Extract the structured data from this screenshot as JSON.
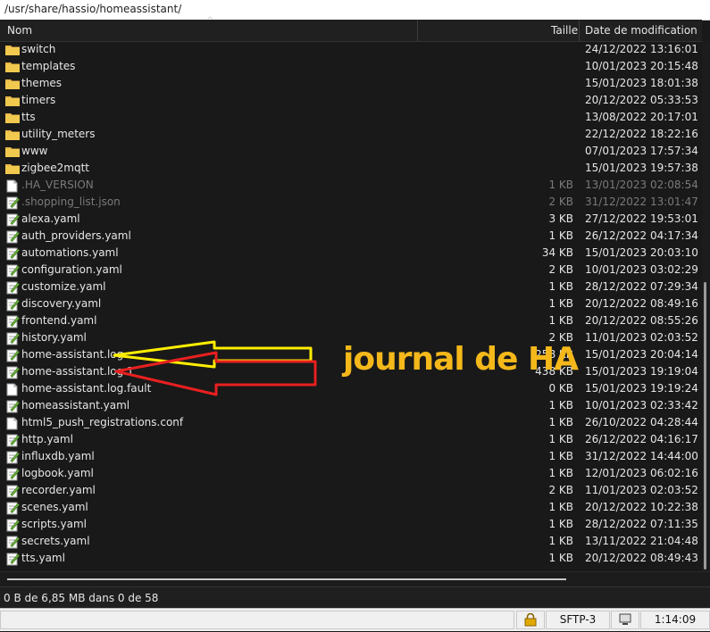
{
  "path": "/usr/share/hassio/homeassistant/",
  "columns": {
    "name": "Nom",
    "size": "Taille",
    "date": "Date de modification"
  },
  "rows": [
    {
      "name": "switch",
      "size": "",
      "date": "24/12/2022 13:16:01",
      "type": "folder"
    },
    {
      "name": "templates",
      "size": "",
      "date": "10/01/2023 20:15:48",
      "type": "folder"
    },
    {
      "name": "themes",
      "size": "",
      "date": "15/01/2023 18:01:38",
      "type": "folder"
    },
    {
      "name": "timers",
      "size": "",
      "date": "20/12/2022 05:33:53",
      "type": "folder"
    },
    {
      "name": "tts",
      "size": "",
      "date": "13/08/2022 20:17:01",
      "type": "folder"
    },
    {
      "name": "utility_meters",
      "size": "",
      "date": "22/12/2022 18:22:16",
      "type": "folder"
    },
    {
      "name": "www",
      "size": "",
      "date": "07/01/2023 17:57:34",
      "type": "folder"
    },
    {
      "name": "zigbee2mqtt",
      "size": "",
      "date": "15/01/2023 19:57:38",
      "type": "folder"
    },
    {
      "name": ".HA_VERSION",
      "size": "1 KB",
      "date": "13/01/2023 02:08:54",
      "type": "file",
      "hidden": true
    },
    {
      "name": ".shopping_list.json",
      "size": "2 KB",
      "date": "31/12/2022 13:01:47",
      "type": "note",
      "hidden": true
    },
    {
      "name": "alexa.yaml",
      "size": "3 KB",
      "date": "27/12/2022 19:53:01",
      "type": "note"
    },
    {
      "name": "auth_providers.yaml",
      "size": "1 KB",
      "date": "26/12/2022 04:17:34",
      "type": "note"
    },
    {
      "name": "automations.yaml",
      "size": "34 KB",
      "date": "15/01/2023 20:03:10",
      "type": "note"
    },
    {
      "name": "configuration.yaml",
      "size": "2 KB",
      "date": "10/01/2023 03:02:29",
      "type": "note"
    },
    {
      "name": "customize.yaml",
      "size": "1 KB",
      "date": "28/12/2022 07:29:34",
      "type": "note"
    },
    {
      "name": "discovery.yaml",
      "size": "1 KB",
      "date": "20/12/2022 08:49:16",
      "type": "note"
    },
    {
      "name": "frontend.yaml",
      "size": "1 KB",
      "date": "20/12/2022 08:55:26",
      "type": "note"
    },
    {
      "name": "history.yaml",
      "size": "2 KB",
      "date": "11/01/2023 02:03:52",
      "type": "note"
    },
    {
      "name": "home-assistant.log",
      "size": "258 KB",
      "date": "15/01/2023 20:04:14",
      "type": "note"
    },
    {
      "name": "home-assistant.log.1",
      "size": "438 KB",
      "date": "15/01/2023 19:19:04",
      "type": "note"
    },
    {
      "name": "home-assistant.log.fault",
      "size": "0 KB",
      "date": "15/01/2023 19:19:24",
      "type": "file"
    },
    {
      "name": "homeassistant.yaml",
      "size": "1 KB",
      "date": "10/01/2023 02:33:42",
      "type": "note"
    },
    {
      "name": "html5_push_registrations.conf",
      "size": "1 KB",
      "date": "26/10/2022 04:28:44",
      "type": "file"
    },
    {
      "name": "http.yaml",
      "size": "1 KB",
      "date": "26/12/2022 04:16:17",
      "type": "note"
    },
    {
      "name": "influxdb.yaml",
      "size": "1 KB",
      "date": "31/12/2022 14:44:00",
      "type": "note"
    },
    {
      "name": "logbook.yaml",
      "size": "1 KB",
      "date": "12/01/2023 06:02:16",
      "type": "note"
    },
    {
      "name": "recorder.yaml",
      "size": "2 KB",
      "date": "11/01/2023 02:03:52",
      "type": "note"
    },
    {
      "name": "scenes.yaml",
      "size": "1 KB",
      "date": "20/12/2022 10:22:38",
      "type": "note"
    },
    {
      "name": "scripts.yaml",
      "size": "1 KB",
      "date": "28/12/2022 07:11:35",
      "type": "note"
    },
    {
      "name": "secrets.yaml",
      "size": "1 KB",
      "date": "13/11/2022 21:04:48",
      "type": "note"
    },
    {
      "name": "tts.yaml",
      "size": "1 KB",
      "date": "20/12/2022 08:49:43",
      "type": "note"
    }
  ],
  "status": "0 B de 6,85 MB dans 0 de 58",
  "bottom": {
    "protocol": "SFTP-3",
    "time": "1:14:09"
  },
  "annotation": {
    "text": "journal de HA",
    "color": "#f4b81a"
  },
  "colors": {
    "folder": "#e8b84a",
    "arrow_yellow": "#ffee00",
    "arrow_red": "#e82020"
  }
}
